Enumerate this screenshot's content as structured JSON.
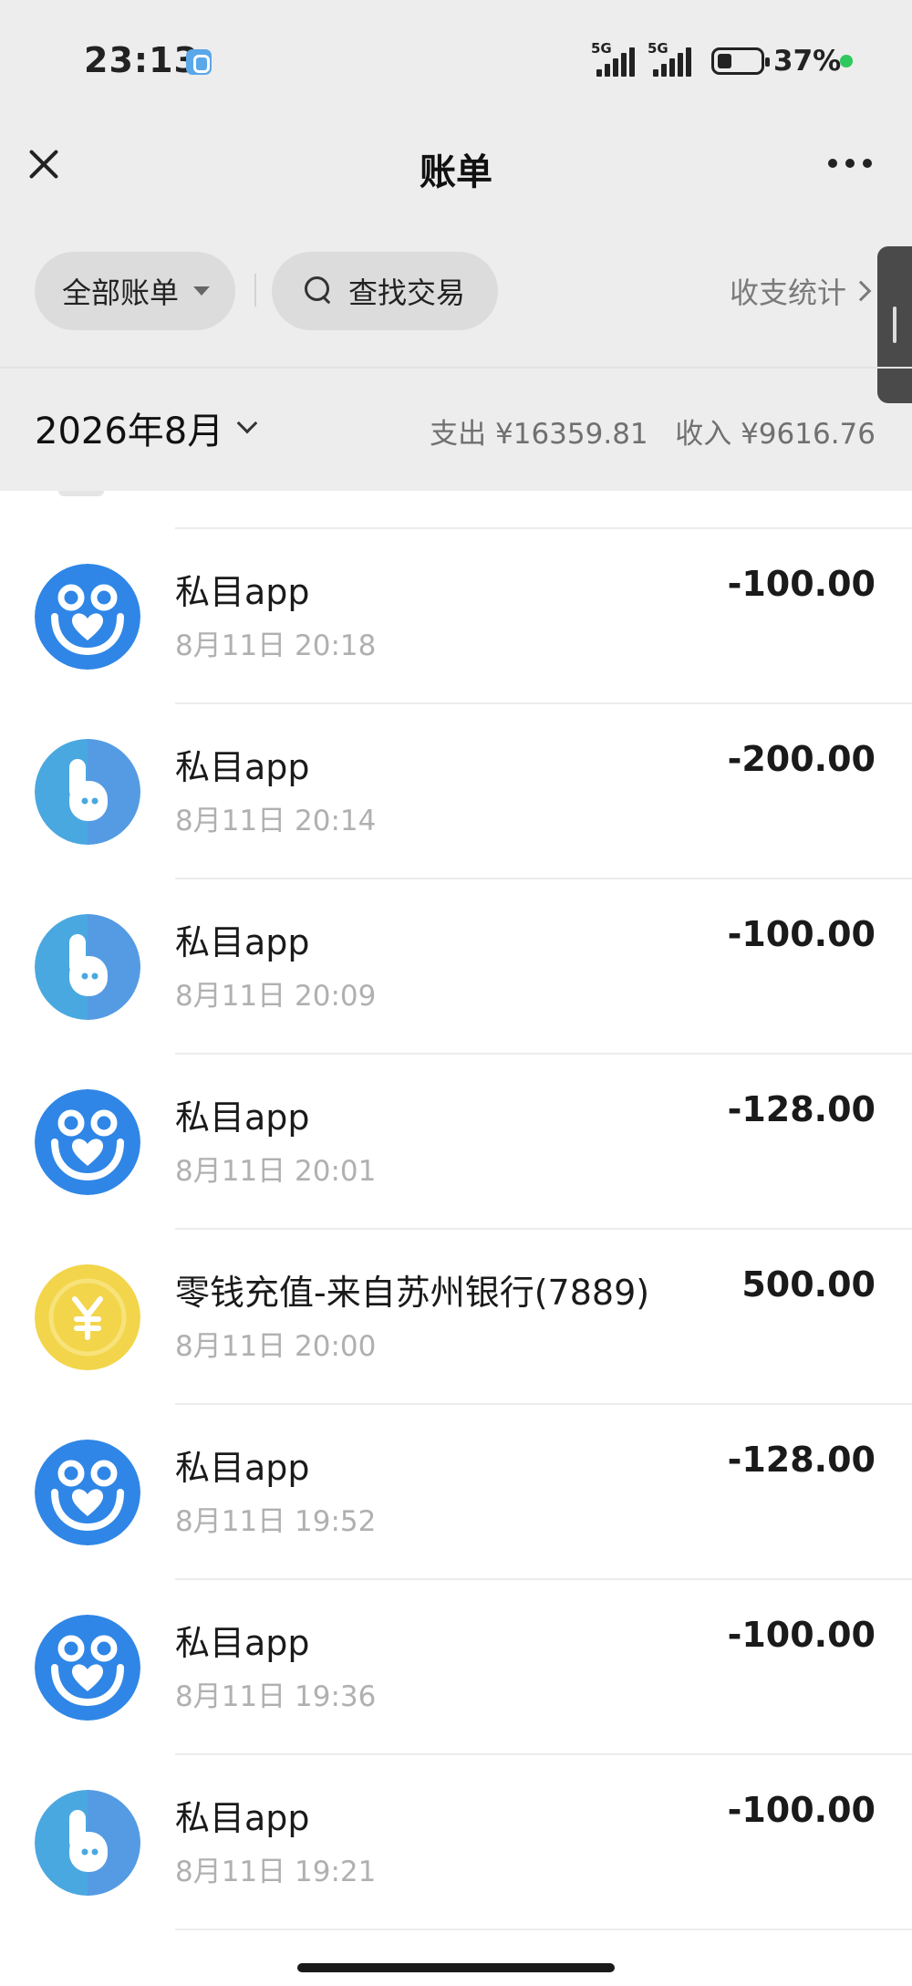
{
  "status_bar": {
    "time": "23:13",
    "net1": "5G",
    "net2": "5G",
    "battery": "37%"
  },
  "nav": {
    "title": "账单"
  },
  "filters": {
    "all_bills": "全部账单",
    "search": "查找交易",
    "stats": "收支统计"
  },
  "summary": {
    "month": "2026年8月",
    "expense": "支出 ¥16359.81",
    "income": "收入 ¥9616.76"
  },
  "colors": {
    "background_top": "#ededed",
    "blue_avatar": "#2f86e6",
    "teal_avatar": "#4aa8e0",
    "coin_yellow": "#f2d54a"
  },
  "transactions": [
    {
      "icon": "heart-hands-icon",
      "title": "私目app",
      "time": "8月11日 20:18",
      "amount": "-100.00"
    },
    {
      "icon": "b-logo-icon",
      "title": "私目app",
      "time": "8月11日 20:14",
      "amount": "-200.00"
    },
    {
      "icon": "b-logo-icon",
      "title": "私目app",
      "time": "8月11日 20:09",
      "amount": "-100.00"
    },
    {
      "icon": "heart-hands-icon",
      "title": "私目app",
      "time": "8月11日 20:01",
      "amount": "-128.00"
    },
    {
      "icon": "yen-coin-icon",
      "title": "零钱充值-来自苏州银行(7889)",
      "time": "8月11日 20:00",
      "amount": "500.00"
    },
    {
      "icon": "heart-hands-icon",
      "title": "私目app",
      "time": "8月11日 19:52",
      "amount": "-128.00"
    },
    {
      "icon": "heart-hands-icon",
      "title": "私目app",
      "time": "8月11日 19:36",
      "amount": "-100.00"
    },
    {
      "icon": "b-logo-icon",
      "title": "私目app",
      "time": "8月11日 19:21",
      "amount": "-100.00"
    }
  ]
}
